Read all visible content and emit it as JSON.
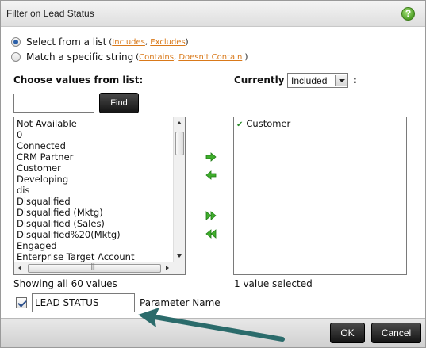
{
  "dialog": {
    "title": "Filter on Lead Status",
    "help_icon": "question-icon"
  },
  "options": {
    "select_from_list": {
      "label": "Select from a list",
      "paren_open": "(",
      "link1": "Includes",
      "sep": ",",
      "link2": "Excludes",
      "paren_close": ")",
      "checked": true
    },
    "match_string": {
      "label": "Match a specific string",
      "paren_open": "(",
      "link1": "Contains",
      "sep": ",",
      "link2": "Doesn't Contain",
      "paren_close": ")",
      "checked": false
    }
  },
  "available": {
    "heading": "Choose values from list:",
    "search_value": "",
    "find_label": "Find",
    "items": [
      "Not Available",
      "0",
      "Connected",
      "CRM Partner",
      "Customer",
      "Developing",
      "dis",
      "Disqualified",
      "Disqualified (Mktg)",
      "Disqualified (Sales)",
      "Disqualified%20(Mktg)",
      "Engaged",
      "Enterprise Target Account"
    ],
    "status": "Showing all 60 values"
  },
  "currently": {
    "heading": "Currently",
    "mode_value": "Included",
    "colon": ":",
    "items": [
      "Customer"
    ],
    "status": "1 value selected"
  },
  "transfer_buttons": [
    "add-right-icon",
    "remove-left-icon",
    "add-all-right-icon",
    "remove-all-left-icon"
  ],
  "parameter": {
    "checked": true,
    "value": "LEAD STATUS",
    "label": "Parameter Name"
  },
  "footer": {
    "ok_label": "OK",
    "cancel_label": "Cancel"
  },
  "colors": {
    "link": "#d9791a",
    "arrow_green": "#3fae2c",
    "annotation_arrow": "#2b6b6b",
    "button_dark": "#1a1a1a"
  }
}
